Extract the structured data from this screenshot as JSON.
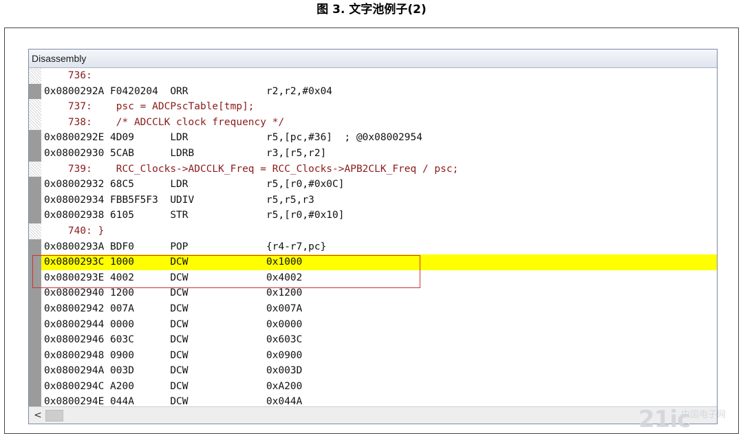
{
  "caption": "图 3. 文字池例子(2)",
  "window": {
    "title": "Disassembly"
  },
  "lines": [
    {
      "kind": "src",
      "text": "    736:"
    },
    {
      "kind": "asm",
      "text": "0x0800292A F0420204  ORR             r2,r2,#0x04"
    },
    {
      "kind": "src",
      "text": "    737:    psc = ADCPscTable[tmp];"
    },
    {
      "kind": "src",
      "text": "    738:    /* ADCCLK clock frequency */"
    },
    {
      "kind": "asm",
      "text": "0x0800292E 4D09      LDR             r5,[pc,#36]  ; @0x08002954"
    },
    {
      "kind": "asm",
      "text": "0x08002930 5CAB      LDRB            r3,[r5,r2]"
    },
    {
      "kind": "src",
      "text": "    739:    RCC_Clocks->ADCCLK_Freq = RCC_Clocks->APB2CLK_Freq / psc;"
    },
    {
      "kind": "asm",
      "text": "0x08002932 68C5      LDR             r5,[r0,#0x0C]"
    },
    {
      "kind": "asm",
      "text": "0x08002934 FBB5F5F3  UDIV            r5,r5,r3"
    },
    {
      "kind": "asm",
      "text": "0x08002938 6105      STR             r5,[r0,#0x10]"
    },
    {
      "kind": "src",
      "text": "    740: }"
    },
    {
      "kind": "asm",
      "text": "0x0800293A BDF0      POP             {r4-r7,pc}"
    },
    {
      "kind": "asm",
      "text": "0x0800293C 1000      DCW             0x1000",
      "highlight": true
    },
    {
      "kind": "asm",
      "text": "0x0800293E 4002      DCW             0x4002"
    },
    {
      "kind": "asm",
      "text": "0x08002940 1200      DCW             0x1200"
    },
    {
      "kind": "asm",
      "text": "0x08002942 007A      DCW             0x007A"
    },
    {
      "kind": "asm",
      "text": "0x08002944 0000      DCW             0x0000"
    },
    {
      "kind": "asm",
      "text": "0x08002946 603C      DCW             0x603C"
    },
    {
      "kind": "asm",
      "text": "0x08002948 0900      DCW             0x0900"
    },
    {
      "kind": "asm",
      "text": "0x0800294A 003D      DCW             0x003D"
    },
    {
      "kind": "asm",
      "text": "0x0800294C A200      DCW             0xA200"
    },
    {
      "kind": "asm",
      "text": "0x0800294E 044A      DCW             0x044A"
    }
  ],
  "scrollbar": {
    "left_arrow": "<"
  },
  "watermark": {
    "logo": "21ic",
    "text": "中国电子网"
  },
  "colors": {
    "highlight": "#ffff00",
    "source_text": "#8b1a1a",
    "box": "#d03030"
  }
}
